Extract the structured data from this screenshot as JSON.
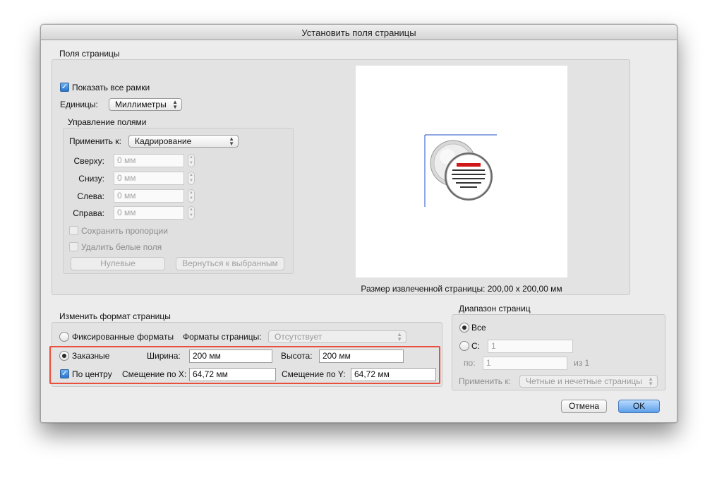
{
  "dialog": {
    "title": "Установить поля страницы"
  },
  "page_margins": {
    "group_label": "Поля страницы",
    "show_all_frames": {
      "label": "Показать все рамки",
      "checked": true
    },
    "units": {
      "label": "Единицы:",
      "value": "Миллиметры"
    },
    "margin_control": {
      "group_label": "Управление полями",
      "apply_to": {
        "label": "Применить к:",
        "value": "Кадрирование"
      },
      "top": {
        "label": "Сверху:",
        "placeholder": "0 мм"
      },
      "bottom": {
        "label": "Снизу:",
        "placeholder": "0 мм"
      },
      "left": {
        "label": "Слева:",
        "placeholder": "0 мм"
      },
      "right": {
        "label": "Справа:",
        "placeholder": "0 мм"
      },
      "keep_proportions": {
        "label": "Сохранить пропорции",
        "checked": false
      },
      "remove_white_margins": {
        "label": "Удалить белые поля",
        "checked": false
      },
      "zero_button": "Нулевые",
      "revert_button": "Вернуться к выбранным"
    },
    "preview": {
      "caption": "Размер извлеченной страницы: 200,00 x 200,00 мм"
    }
  },
  "page_format": {
    "group_label": "Изменить формат страницы",
    "fixed_formats": {
      "label": "Фиксированные форматы",
      "selected": false
    },
    "page_formats": {
      "label": "Форматы страницы:",
      "value": "Отсутствует"
    },
    "custom": {
      "label": "Заказные",
      "selected": true
    },
    "width": {
      "label": "Ширина:",
      "value": "200 мм"
    },
    "height": {
      "label": "Высота:",
      "value": "200 мм"
    },
    "center": {
      "label": "По центру",
      "checked": true
    },
    "offset_x": {
      "label": "Смещение по X:",
      "value": "64,72 мм"
    },
    "offset_y": {
      "label": "Смещение по Y:",
      "value": "64,72 мм"
    }
  },
  "page_range": {
    "group_label": "Диапазон страниц",
    "all": {
      "label": "Все",
      "selected": true
    },
    "from": {
      "label": "С:",
      "placeholder": "1"
    },
    "to": {
      "label": "по:",
      "placeholder": "1",
      "suffix": "из 1"
    },
    "apply_to": {
      "label": "Применить к:",
      "value": "Четные и нечетные страницы"
    }
  },
  "buttons": {
    "cancel": "Отмена",
    "ok": "OK"
  },
  "colors": {
    "highlight": "#e84f3c",
    "accent": "#3b82d8",
    "crop_line": "#1f4fc8"
  }
}
